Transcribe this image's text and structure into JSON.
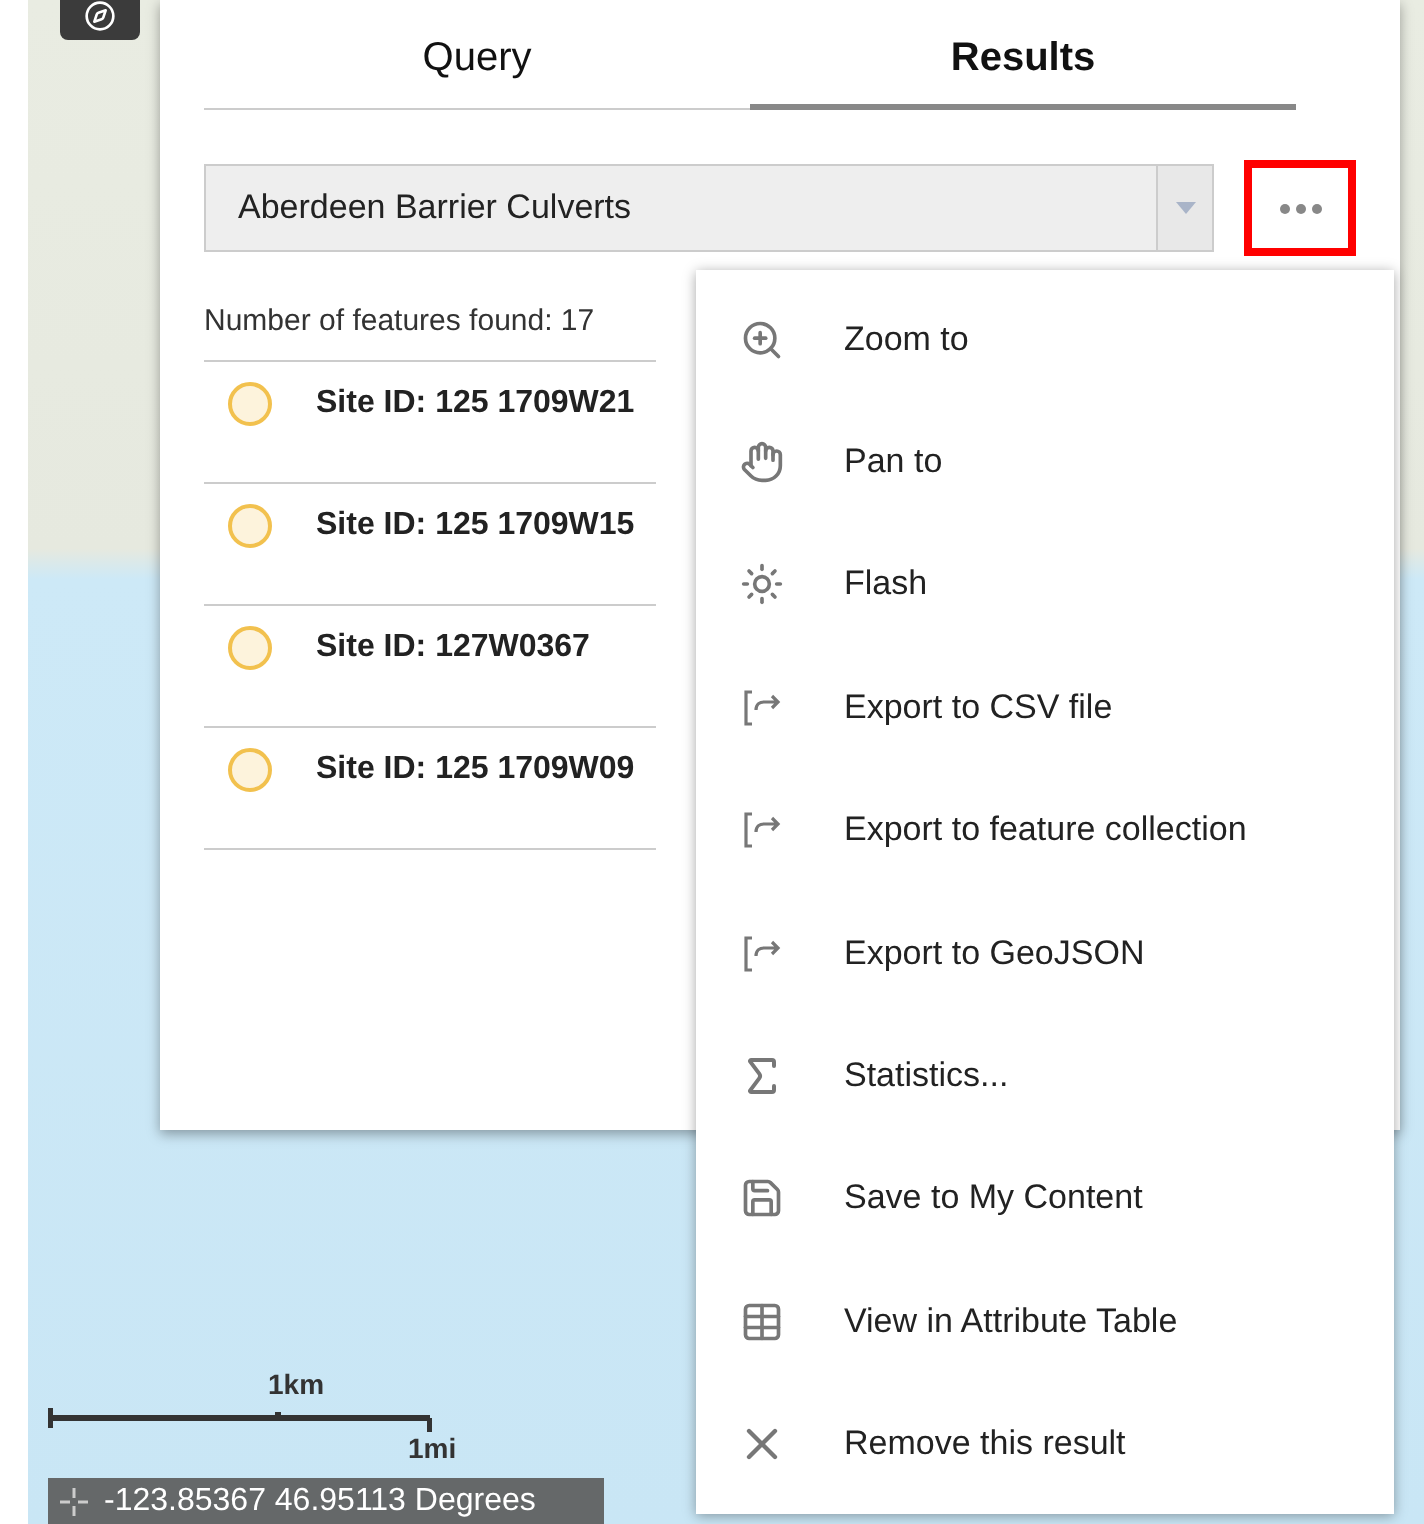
{
  "tabs": [
    {
      "label": "Query",
      "selected": false
    },
    {
      "label": "Results",
      "selected": true
    }
  ],
  "layer_select": {
    "value": "Aberdeen Barrier Culverts"
  },
  "more_button": {
    "highlighted": true
  },
  "feature_count": "Number of features found: 17",
  "results": [
    {
      "label": "Site ID: 125 1709W21",
      "color": "#f2c14e"
    },
    {
      "label": "Site ID: 125 1709W15",
      "color": "#f2c14e"
    },
    {
      "label": "Site ID: 127W0367",
      "color": "#f2c14e"
    },
    {
      "label": "Site ID: 125 1709W09",
      "color": "#f2c14e"
    }
  ],
  "menu": [
    {
      "kind": "zoom",
      "label": "Zoom to"
    },
    {
      "kind": "pan",
      "label": "Pan to"
    },
    {
      "kind": "flash",
      "label": "Flash"
    },
    {
      "kind": "export",
      "label": "Export to CSV file"
    },
    {
      "kind": "export",
      "label": "Export to feature collection"
    },
    {
      "kind": "export",
      "label": "Export to GeoJSON"
    },
    {
      "kind": "statistics",
      "label": "Statistics..."
    },
    {
      "kind": "save",
      "label": "Save to My Content"
    },
    {
      "kind": "table",
      "label": "View in Attribute Table"
    },
    {
      "kind": "remove",
      "label": "Remove this result"
    }
  ],
  "scale_bar": {
    "metric": "1km",
    "imperial": "1mi"
  },
  "coordinates": "-123.85367 46.95113 Degrees"
}
